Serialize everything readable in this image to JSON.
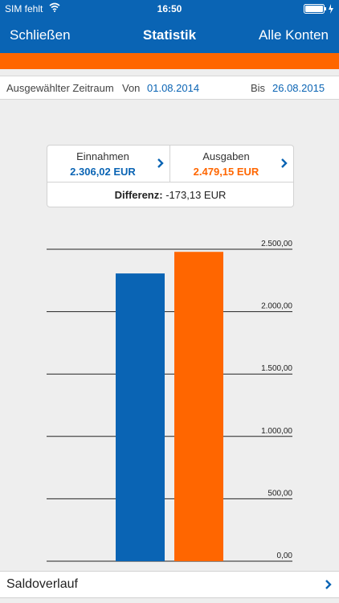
{
  "status_bar": {
    "carrier": "SIM fehlt",
    "time": "16:50"
  },
  "nav": {
    "left_button": "Schließen",
    "title": "Statistik",
    "right_button": "Alle Konten"
  },
  "period": {
    "label": "Ausgewählter Zeitraum",
    "from_label": "Von",
    "from_date": "01.08.2014",
    "to_label": "Bis",
    "to_date": "26.08.2015"
  },
  "summary": {
    "income_label": "Einnahmen",
    "income_value": "2.306,02 EUR",
    "expenses_label": "Ausgaben",
    "expenses_value": "2.479,15 EUR",
    "difference_label": "Differenz:",
    "difference_value": "-173,13 EUR"
  },
  "colors": {
    "primary": "#0a64b4",
    "accent": "#ff6600"
  },
  "chart_data": {
    "type": "bar",
    "categories": [
      "Einnahmen",
      "Ausgaben"
    ],
    "values": [
      2306.02,
      2479.15
    ],
    "colors": [
      "#0a64b4",
      "#ff6600"
    ],
    "ylim": [
      0,
      2500
    ],
    "yticks": [
      2500,
      2000,
      1500,
      1000,
      500,
      0
    ],
    "ytick_labels": [
      "2.500,00",
      "2.000,00",
      "1.500,00",
      "1.000,00",
      "500,00",
      "0,00"
    ],
    "grid": true
  },
  "footer": {
    "saldo_label": "Saldoverlauf"
  }
}
